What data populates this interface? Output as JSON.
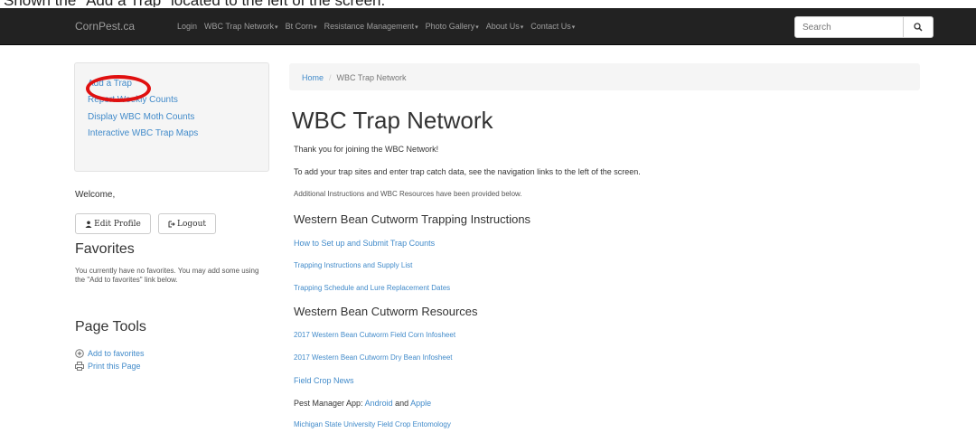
{
  "caption": "Shown the \"Add a Trap\" located to the left of the screen.",
  "navbar": {
    "brand": "CornPest.ca",
    "items": [
      {
        "label": "Login",
        "caret": false
      },
      {
        "label": "WBC Trap Network",
        "caret": true
      },
      {
        "label": "Bt Corn",
        "caret": true
      },
      {
        "label": "Resistance Management",
        "caret": true
      },
      {
        "label": "Photo Gallery",
        "caret": true
      },
      {
        "label": "About Us",
        "caret": true
      },
      {
        "label": "Contact Us",
        "caret": true
      }
    ],
    "search_placeholder": "Search",
    "search_icon": "search-icon"
  },
  "sidebar": {
    "links": [
      "Add a Trap",
      "Report Weekly Counts",
      "Display WBC Moth Counts",
      "Interactive WBC Trap Maps"
    ],
    "welcome": "Welcome,",
    "edit_profile": "Edit Profile",
    "logout": "Logout",
    "favorites_heading": "Favorites",
    "favorites_note": "You currently have no favorites. You may add some using the \"Add to favorites\" link below.",
    "page_tools_heading": "Page Tools",
    "add_favorites": "Add to favorites",
    "print_page": "Print this Page"
  },
  "breadcrumb": {
    "home": "Home",
    "current": "WBC Trap Network"
  },
  "main": {
    "title": "WBC Trap Network",
    "intro1": "Thank you for joining the WBC Network!",
    "intro2": "To add your trap sites and enter trap catch data, see the navigation links to the left of the screen.",
    "intro3": "Additional Instructions and WBC Resources have been provided below.",
    "section1": "Western Bean Cutworm Trapping Instructions",
    "s1_links": [
      "How to Set up and Submit Trap Counts",
      "Trapping Instructions and Supply List",
      "Trapping Schedule and Lure Replacement Dates"
    ],
    "section2": "Western Bean Cutworm Resources",
    "s2_links": [
      "2017 Western Bean Cutworm Field Corn Infosheet",
      "2017 Western Bean Cutworm Dry Bean Infosheet",
      "Field Crop News"
    ],
    "pest_app_prefix": "Pest Manager App: ",
    "pest_app_android": "Android",
    "pest_app_and": " and ",
    "pest_app_apple": "Apple",
    "msu_link": "Michigan State University Field Crop Entomology"
  },
  "colors": {
    "accent": "#428bca",
    "navbar": "#222222",
    "highlight": "#e01010"
  }
}
